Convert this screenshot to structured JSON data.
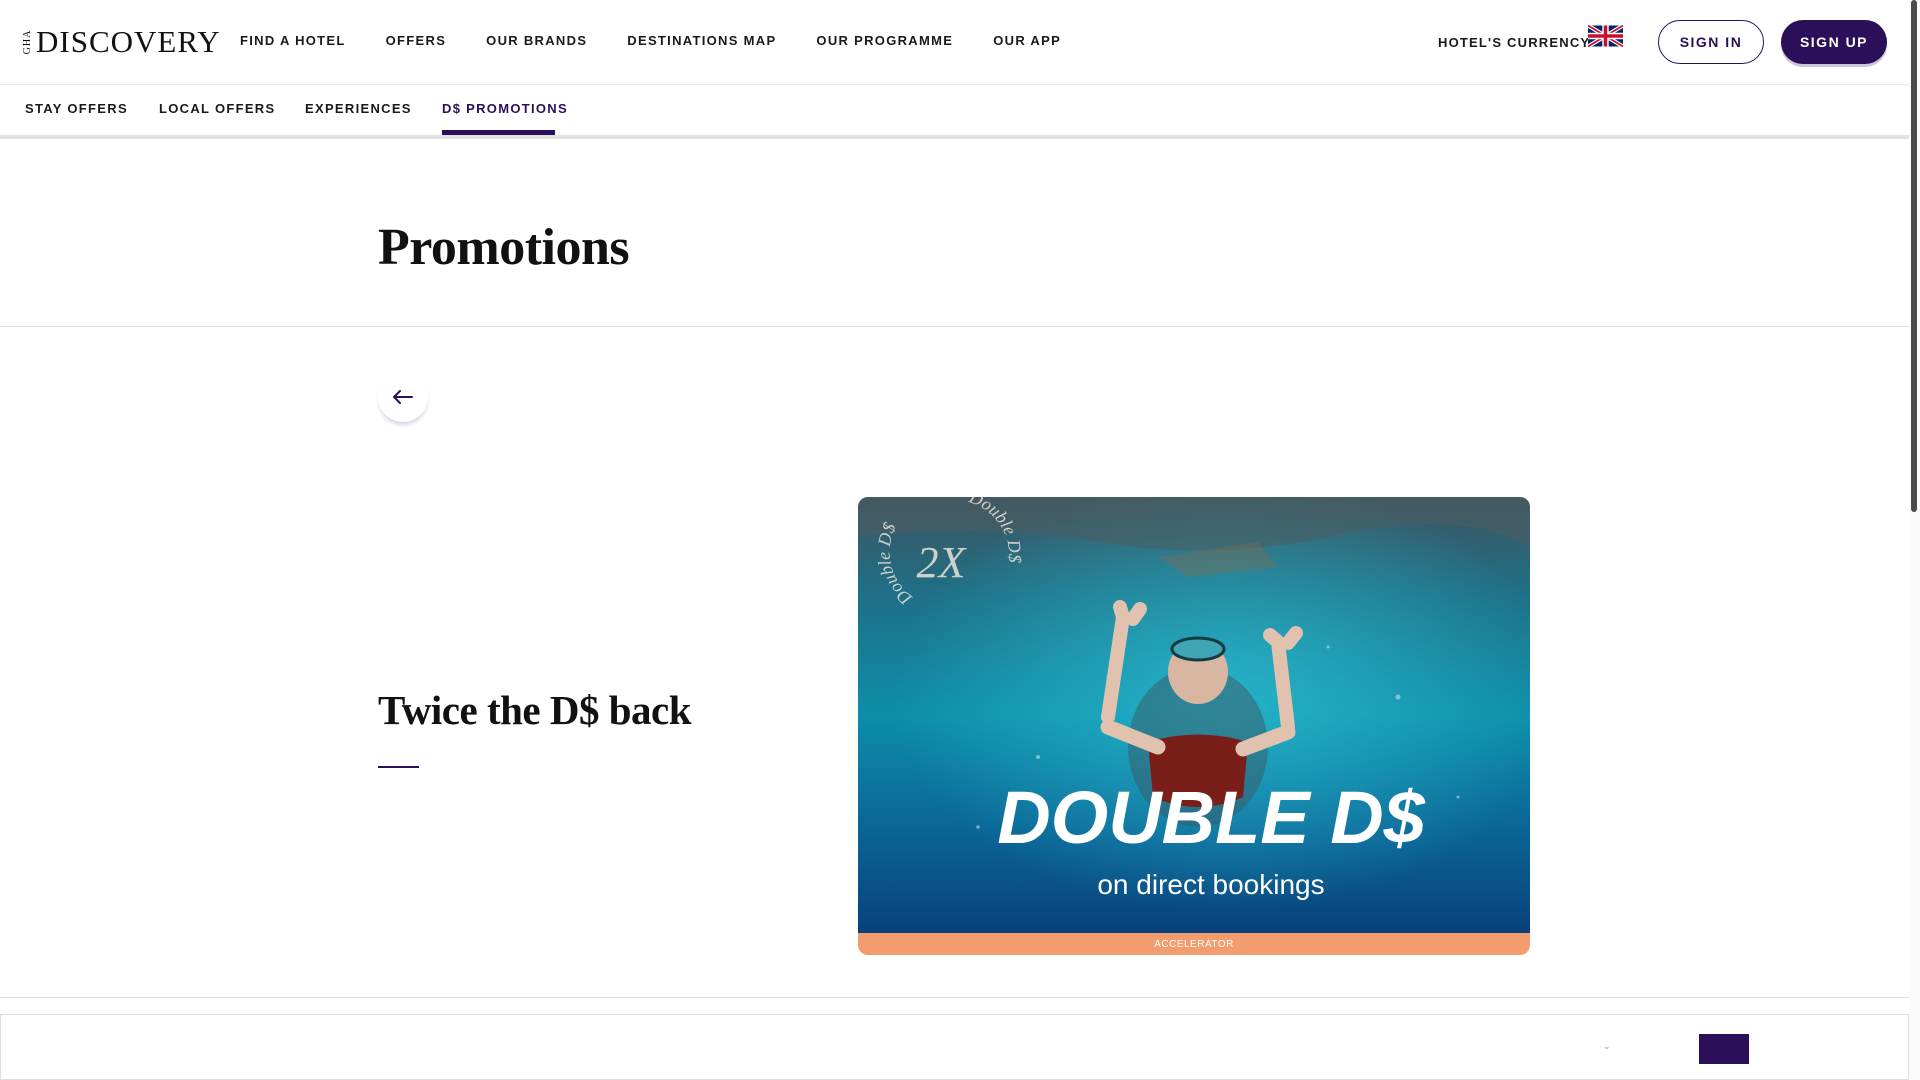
{
  "logo": {
    "gha": "GHA",
    "name": "DISCOVERY"
  },
  "main_nav": [
    "FIND A HOTEL",
    "OFFERS",
    "OUR BRANDS",
    "DESTINATIONS MAP",
    "OUR PROGRAMME",
    "OUR APP"
  ],
  "header": {
    "currency_label": "HOTEL'S CURRENCY",
    "language_flag": "uk-flag-icon",
    "sign_in": "SIGN IN",
    "sign_up": "SIGN UP"
  },
  "sub_nav": {
    "tabs": [
      "STAY OFFERS",
      "LOCAL OFFERS",
      "EXPERIENCES",
      "D$ PROMOTIONS"
    ],
    "active": "D$ PROMOTIONS"
  },
  "page": {
    "title": "Promotions",
    "back_icon": "arrow-left-icon"
  },
  "promotion": {
    "title": "Twice the D$ back",
    "image": {
      "badge_big": "2X",
      "badge_ring": "Double D$",
      "headline": "DOUBLE D$",
      "subline": "on direct bookings"
    },
    "tag": "ACCELERATOR"
  },
  "colors": {
    "brand": "#2b0f59",
    "tag": "#f39d6f"
  }
}
